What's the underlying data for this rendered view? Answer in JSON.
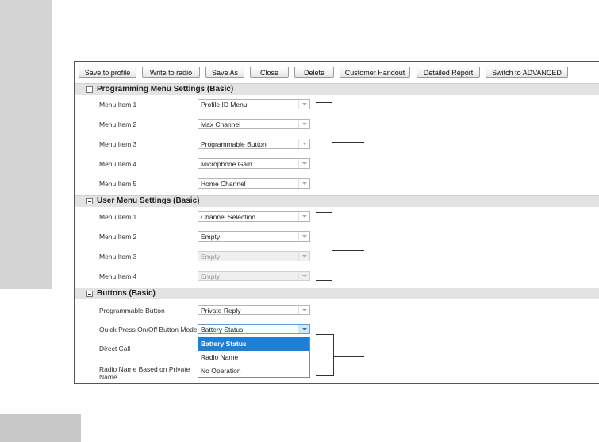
{
  "toolbar": {
    "save_to_profile": "Save to profile",
    "write_to_radio": "Write to radio",
    "save_as": "Save As",
    "close": "Close",
    "delete": "Delete",
    "customer_handout": "Customer Handout",
    "detailed_report": "Detailed Report",
    "switch_advanced": "Switch to ADVANCED"
  },
  "programming_menu": {
    "title": "Programming Menu Settings (Basic)",
    "items": [
      {
        "label": "Menu Item 1",
        "value": "Profile ID Menu"
      },
      {
        "label": "Menu Item 2",
        "value": "Max Channel"
      },
      {
        "label": "Menu Item 3",
        "value": "Programmable Button"
      },
      {
        "label": "Menu Item 4",
        "value": "Microphone Gain"
      },
      {
        "label": "Menu Item 5",
        "value": "Home Channel"
      }
    ]
  },
  "user_menu": {
    "title": "User Menu Settings (Basic)",
    "items": [
      {
        "label": "Menu Item 1",
        "value": "Channel Selection",
        "disabled": false
      },
      {
        "label": "Menu Item 2",
        "value": "Empty",
        "disabled": false
      },
      {
        "label": "Menu Item 3",
        "value": "Empty",
        "disabled": true
      },
      {
        "label": "Menu Item 4",
        "value": "Empty",
        "disabled": true
      }
    ]
  },
  "buttons": {
    "title": "Buttons (Basic)",
    "programmable_button": {
      "label": "Programmable Button",
      "value": "Private Reply"
    },
    "quick_press": {
      "label": "Quick Press On/Off Button Mode",
      "value": "Battery Status"
    },
    "direct_call": {
      "label": "Direct Call"
    },
    "radio_name": {
      "label_line1": "Radio Name Based on Private",
      "label_line2": "Name"
    },
    "dropdown_options": [
      "Battery Status",
      "Radio Name",
      "No Operation"
    ]
  },
  "colors": {
    "highlight": "#1f7fd4",
    "section_bg": "#e3e3e3",
    "side_tab": "#d4d4d4"
  }
}
